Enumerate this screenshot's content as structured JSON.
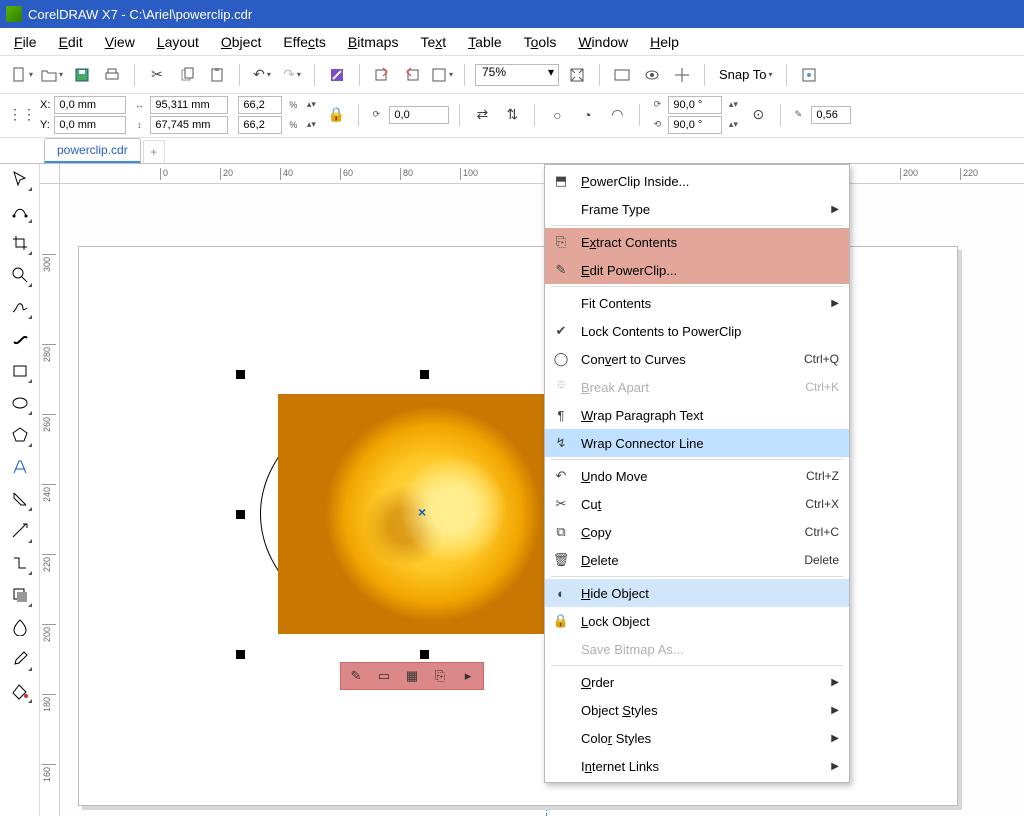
{
  "window": {
    "title": "CorelDRAW X7 - C:\\Ariel\\powerclip.cdr"
  },
  "menubar": [
    "File",
    "Edit",
    "View",
    "Layout",
    "Object",
    "Effects",
    "Bitmaps",
    "Text",
    "Table",
    "Tools",
    "Window",
    "Help"
  ],
  "toolbar": {
    "zoom": "75%",
    "snap": "Snap To"
  },
  "propbar": {
    "x": "0,0 mm",
    "y": "0,0 mm",
    "w": "95,311 mm",
    "h": "67,745 mm",
    "sx": "66,2",
    "sy": "66,2",
    "rot": "0,0",
    "ang1": "90,0 °",
    "ang2": "90,0 °",
    "outline": "0,56"
  },
  "tab": {
    "name": "powerclip.cdr"
  },
  "ruler_h": [
    "0",
    "20",
    "40",
    "60",
    "80",
    "100",
    "200",
    "220"
  ],
  "ruler_v": [
    "300",
    "280",
    "260",
    "240",
    "220",
    "200",
    "180",
    "160"
  ],
  "context_menu": {
    "items": [
      {
        "icon": "pc-inside",
        "label": "PowerClip Inside...",
        "u": "P"
      },
      {
        "label": "Frame Type",
        "sub": true
      },
      {
        "sep": true
      },
      {
        "icon": "extract",
        "label": "Extract Contents",
        "u": "x",
        "hl": "red"
      },
      {
        "icon": "edit-pc",
        "label": "Edit PowerClip...",
        "u": "E",
        "hl": "red"
      },
      {
        "sep": true
      },
      {
        "label": "Fit Contents",
        "sub": true
      },
      {
        "icon": "check",
        "label": "Lock Contents to PowerClip"
      },
      {
        "icon": "curves",
        "label": "Convert to Curves",
        "u": "v",
        "sc": "Ctrl+Q"
      },
      {
        "icon": "break",
        "label": "Break Apart",
        "u": "B",
        "sc": "Ctrl+K",
        "dis": true
      },
      {
        "icon": "wrapP",
        "label": "Wrap Paragraph Text",
        "u": "W"
      },
      {
        "icon": "wrapC",
        "label": "Wrap Connector Line",
        "sel": true
      },
      {
        "sep": true
      },
      {
        "icon": "undo",
        "label": "Undo Move",
        "u": "U",
        "sc": "Ctrl+Z"
      },
      {
        "icon": "cut",
        "label": "Cut",
        "u": "t",
        "sc": "Ctrl+X"
      },
      {
        "icon": "copy",
        "label": "Copy",
        "u": "C",
        "sc": "Ctrl+C"
      },
      {
        "icon": "delete",
        "label": "Delete",
        "u": "D",
        "sc": "Delete"
      },
      {
        "sep": true
      },
      {
        "icon": "hide",
        "label": "Hide Object",
        "u": "H",
        "hl": "blue"
      },
      {
        "icon": "lock",
        "label": "Lock Object",
        "u": "L"
      },
      {
        "label": "Save Bitmap As...",
        "dis": true
      },
      {
        "sep": true
      },
      {
        "label": "Order",
        "u": "O",
        "sub": true
      },
      {
        "label": "Object Styles",
        "u": "S",
        "sub": true
      },
      {
        "label": "Color Styles",
        "u": "r",
        "sub": true
      },
      {
        "label": "Internet Links",
        "u": "n",
        "sub": true
      }
    ]
  }
}
